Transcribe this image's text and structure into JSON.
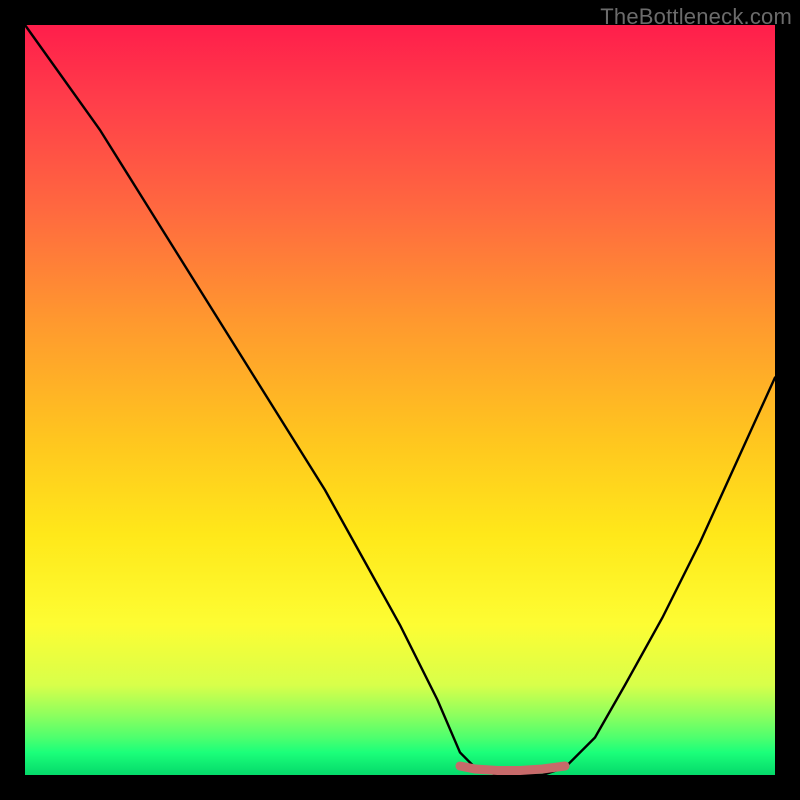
{
  "watermark": "TheBottleneck.com",
  "chart_data": {
    "type": "line",
    "title": "",
    "xlabel": "",
    "ylabel": "",
    "xlim": [
      0,
      100
    ],
    "ylim": [
      0,
      100
    ],
    "grid": false,
    "legend": false,
    "annotations": [],
    "background_gradient_stops": [
      {
        "pos": 0,
        "color": "#ff1e4b"
      },
      {
        "pos": 25,
        "color": "#ff6a3f"
      },
      {
        "pos": 55,
        "color": "#ffc51f"
      },
      {
        "pos": 80,
        "color": "#fdfd33"
      },
      {
        "pos": 95,
        "color": "#4eff6e"
      },
      {
        "pos": 100,
        "color": "#05d96a"
      }
    ],
    "series": [
      {
        "name": "bottleneck-curve",
        "color": "#000000",
        "x": [
          0,
          5,
          10,
          15,
          20,
          25,
          30,
          35,
          40,
          45,
          50,
          55,
          58,
          60,
          63,
          66,
          69,
          72,
          76,
          80,
          85,
          90,
          95,
          100
        ],
        "y": [
          100,
          93,
          86,
          78,
          70,
          62,
          54,
          46,
          38,
          29,
          20,
          10,
          3,
          1,
          0,
          0,
          0,
          1,
          5,
          12,
          21,
          31,
          42,
          53
        ]
      },
      {
        "name": "optimal-band-marker",
        "color": "#c76a6a",
        "x": [
          58,
          60,
          63,
          66,
          69,
          72
        ],
        "y": [
          1.2,
          0.8,
          0.6,
          0.6,
          0.8,
          1.2
        ]
      }
    ]
  }
}
